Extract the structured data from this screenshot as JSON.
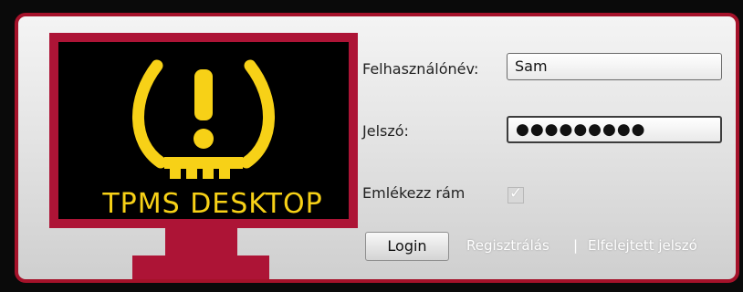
{
  "logo": {
    "text": "TPMS DESKTOP",
    "icon": "tpms-warning-icon",
    "colors": {
      "frame": "#ad1436",
      "screen": "#000000",
      "symbol": "#f7d117"
    }
  },
  "form": {
    "username_label": "Felhasználónév:",
    "username_value": "Sam",
    "password_label": "Jelszó:",
    "password_value": "●●●●●●●●●",
    "remember_label": "Emlékezz rám",
    "remember_checked": true,
    "login_label": "Login",
    "register_link": "Regisztrálás",
    "separator": "|",
    "forgot_link": "Elfelejtett jelszó"
  },
  "theme": {
    "border": "#a5122a",
    "link": "#ffffff"
  }
}
